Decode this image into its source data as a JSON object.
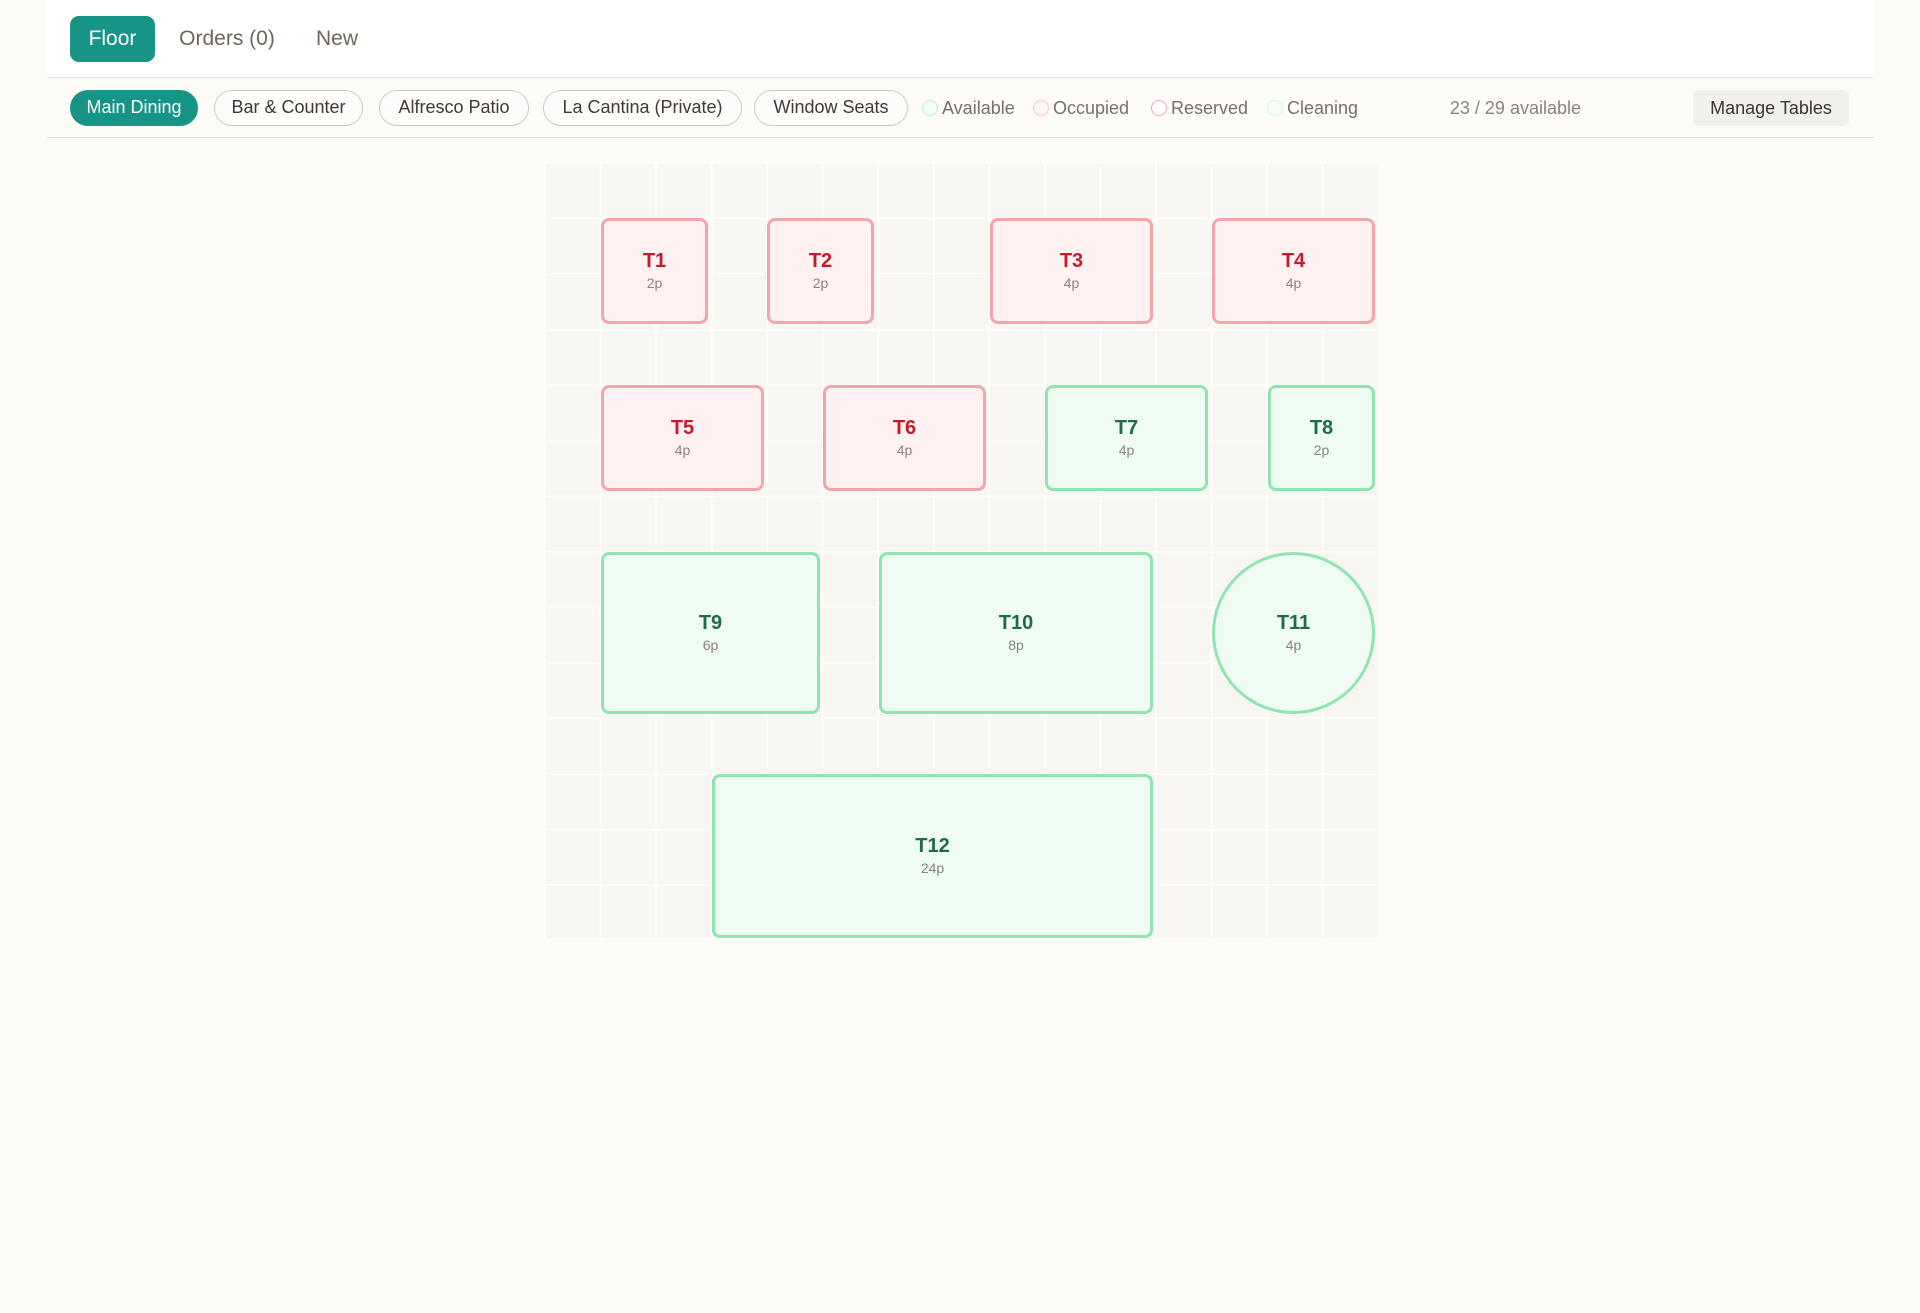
{
  "tabs": [
    {
      "label": "Floor",
      "active": true
    },
    {
      "label": "Orders (0)",
      "active": false
    },
    {
      "label": "New",
      "active": false
    }
  ],
  "areas": [
    {
      "label": "Main Dining",
      "active": true
    },
    {
      "label": "Bar & Counter",
      "active": false
    },
    {
      "label": "Alfresco Patio",
      "active": false
    },
    {
      "label": "La Cantina (Private)",
      "active": false
    },
    {
      "label": "Window Seats",
      "active": false
    }
  ],
  "legend": [
    {
      "label": "Available",
      "color": "#8ee5b0",
      "fill": "#effcf4"
    },
    {
      "label": "Occupied",
      "color": "#f2a5ab",
      "fill": "#fff1f2"
    },
    {
      "label": "Reserved",
      "color": "#f2a5ab",
      "fill": "#ffffff"
    },
    {
      "label": "Cleaning",
      "color": "#bdeed0",
      "fill": "#f4fdf7"
    }
  ],
  "availability": "23 / 29 available",
  "manage_label": "Manage Tables",
  "colors": {
    "accent": "#169486",
    "occupied_text": "#c01d2c",
    "available_text": "#1f6a4d"
  },
  "tables": [
    {
      "name": "T1",
      "capacity": "2p",
      "status": "occupied",
      "shape": "rect"
    },
    {
      "name": "T2",
      "capacity": "2p",
      "status": "occupied",
      "shape": "rect"
    },
    {
      "name": "T3",
      "capacity": "4p",
      "status": "occupied",
      "shape": "rect"
    },
    {
      "name": "T4",
      "capacity": "4p",
      "status": "occupied",
      "shape": "rect"
    },
    {
      "name": "T5",
      "capacity": "4p",
      "status": "occupied",
      "shape": "rect"
    },
    {
      "name": "T6",
      "capacity": "4p",
      "status": "occupied",
      "shape": "rect"
    },
    {
      "name": "T7",
      "capacity": "4p",
      "status": "available",
      "shape": "rect"
    },
    {
      "name": "T8",
      "capacity": "2p",
      "status": "available",
      "shape": "rect"
    },
    {
      "name": "T9",
      "capacity": "6p",
      "status": "available",
      "shape": "rect"
    },
    {
      "name": "T10",
      "capacity": "8p",
      "status": "available",
      "shape": "rect"
    },
    {
      "name": "T11",
      "capacity": "4p",
      "status": "available",
      "shape": "round"
    },
    {
      "name": "T12",
      "capacity": "24p",
      "status": "available",
      "shape": "rect"
    }
  ]
}
